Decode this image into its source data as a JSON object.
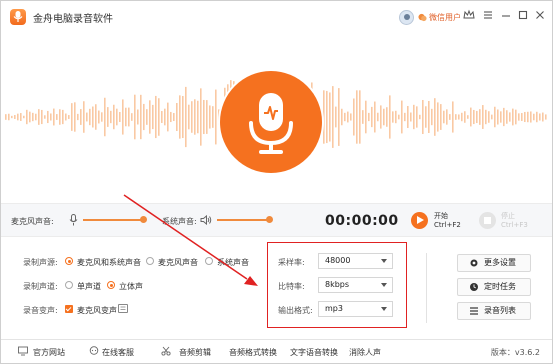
{
  "title_bar": {
    "app_title": "金舟电脑录音软件",
    "user_name": "微信用户",
    "icons": [
      "app-logo-icon",
      "avatar",
      "wechat-icon",
      "crown-icon",
      "menu-icon",
      "minimize-icon",
      "maximize-icon",
      "close-icon"
    ]
  },
  "controls": {
    "mic_volume_label": "麦克风声音:",
    "system_volume_label": "系统声音:",
    "mic_volume_level": 1.0,
    "system_volume_level": 1.0,
    "timer": "00:00:00",
    "start_label": "开始",
    "start_shortcut": "Ctrl+F2",
    "stop_label": "停止",
    "stop_shortcut": "Ctrl+F3"
  },
  "settings": {
    "source_label": "录制声源:",
    "source_options": [
      "麦克风和系统声音",
      "麦克风声音",
      "系统声音"
    ],
    "source_selected": 0,
    "channel_label": "录制声道:",
    "channel_options": [
      "单声道",
      "立体声"
    ],
    "channel_selected": 1,
    "voice_change_label": "录音变声:",
    "voice_change_option": "麦克风变声",
    "voice_change_checked": true
  },
  "format": {
    "sample_rate_label": "采样率:",
    "sample_rate_value": "48000",
    "bitrate_label": "比特率:",
    "bitrate_value": "8kbps",
    "output_format_label": "输出格式:",
    "output_format_value": "mp3"
  },
  "side_buttons": {
    "more_settings": "更多设置",
    "scheduled_task": "定时任务",
    "recording_list": "录音列表"
  },
  "bottom_bar": {
    "website": "官方网站",
    "online_service": "在线客服",
    "audio_edit": "音频剪辑",
    "audio_convert": "音频格式转换",
    "text_to_speech": "文字语音转换",
    "vocal_removal": "消除人声",
    "version": "版本：v3.6.2"
  },
  "colors": {
    "accent": "#f5711f",
    "waveform": "#f9c9a3",
    "highlight": "#e02222"
  }
}
